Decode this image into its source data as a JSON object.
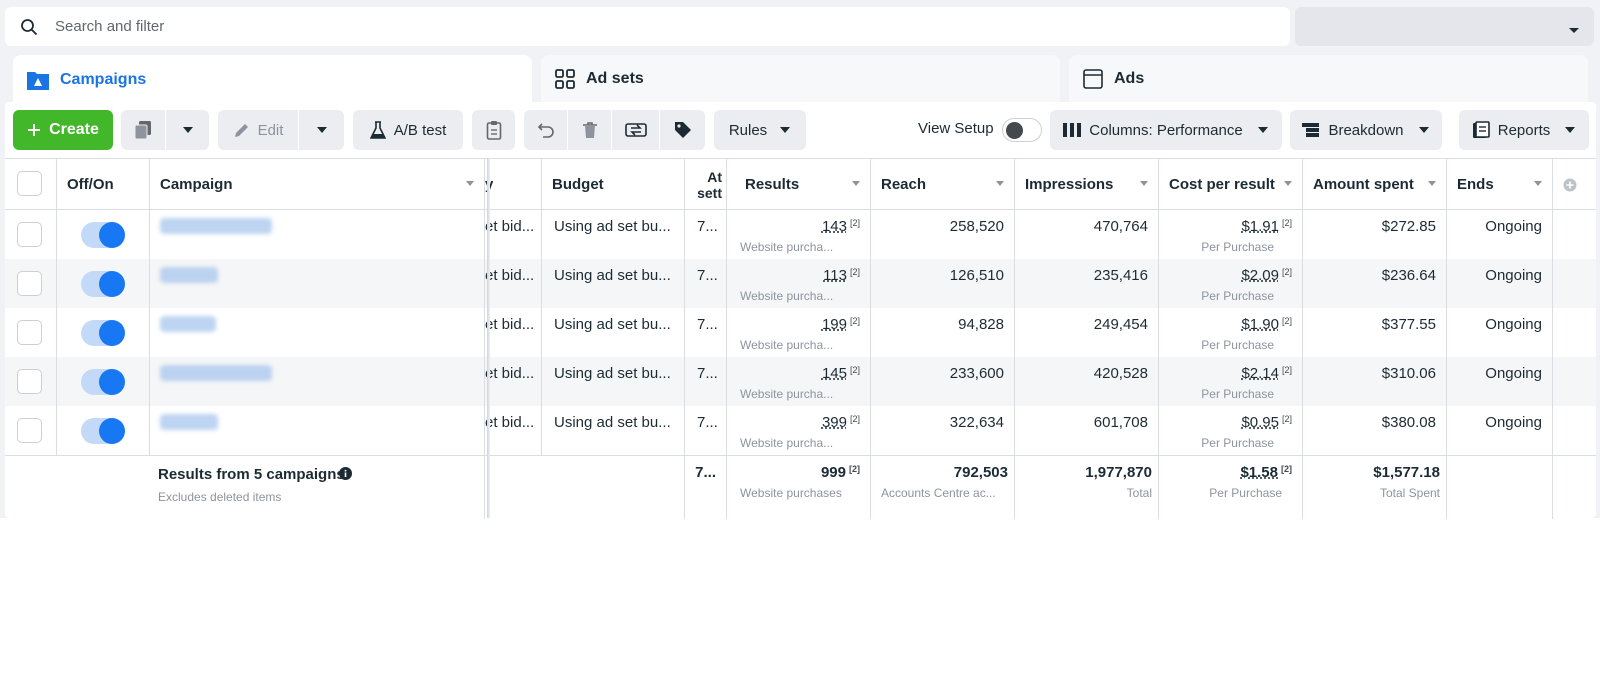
{
  "search": {
    "placeholder": "Search and filter"
  },
  "tabs": [
    {
      "label": "Campaigns"
    },
    {
      "label": "Ad sets"
    },
    {
      "label": "Ads"
    }
  ],
  "toolbar": {
    "create": "Create",
    "edit": "Edit",
    "ab_test": "A/B test",
    "rules": "Rules",
    "view_setup": "View Setup",
    "columns": "Columns: Performance",
    "breakdown": "Breakdown",
    "reports": "Reports"
  },
  "colors": {
    "accent": "#1b74e4",
    "create": "#42b72a",
    "toggle_on": "#1877f2"
  },
  "table": {
    "headers": {
      "off_on": "Off/On",
      "campaign": "Campaign",
      "bid": "y",
      "budget": "Budget",
      "attribution": "At\nsett",
      "results": "Results",
      "reach": "Reach",
      "impressions": "Impressions",
      "cost": "Cost per result",
      "amount": "Amount spent",
      "ends": "Ends"
    },
    "rows": [
      {
        "bid": "et bid...",
        "budget": "Using ad set bu...",
        "attr": "7...",
        "results": "143",
        "results_sub": "Website purcha...",
        "reach": "258,520",
        "impressions": "470,764",
        "cost": "$1.91",
        "cost_sub": "Per Purchase",
        "amount": "$272.85",
        "ends": "Ongoing"
      },
      {
        "bid": "et bid...",
        "budget": "Using ad set bu...",
        "attr": "7...",
        "results": "113",
        "results_sub": "Website purcha...",
        "reach": "126,510",
        "impressions": "235,416",
        "cost": "$2.09",
        "cost_sub": "Per Purchase",
        "amount": "$236.64",
        "ends": "Ongoing"
      },
      {
        "bid": "et bid...",
        "budget": "Using ad set bu...",
        "attr": "7...",
        "results": "199",
        "results_sub": "Website purcha...",
        "reach": "94,828",
        "impressions": "249,454",
        "cost": "$1.90",
        "cost_sub": "Per Purchase",
        "amount": "$377.55",
        "ends": "Ongoing"
      },
      {
        "bid": "et bid...",
        "budget": "Using ad set bu...",
        "attr": "7...",
        "results": "145",
        "results_sub": "Website purcha...",
        "reach": "233,600",
        "impressions": "420,528",
        "cost": "$2.14",
        "cost_sub": "Per Purchase",
        "amount": "$310.06",
        "ends": "Ongoing"
      },
      {
        "bid": "et bid...",
        "budget": "Using ad set bu...",
        "attr": "7...",
        "results": "399",
        "results_sub": "Website purcha...",
        "reach": "322,634",
        "impressions": "601,708",
        "cost": "$0.95",
        "cost_sub": "Per Purchase",
        "amount": "$380.08",
        "ends": "Ongoing"
      }
    ],
    "footnote": "[2]",
    "totals": {
      "label": "Results from 5 campaigns",
      "sub": "Excludes deleted items",
      "attr": "7...",
      "results": "999",
      "results_sub": "Website purchases",
      "reach": "792,503",
      "reach_sub": "Accounts Centre ac...",
      "impressions": "1,977,870",
      "impressions_sub": "Total",
      "cost": "$1.58",
      "cost_sub": "Per Purchase",
      "amount": "$1,577.18",
      "amount_sub": "Total Spent"
    }
  }
}
